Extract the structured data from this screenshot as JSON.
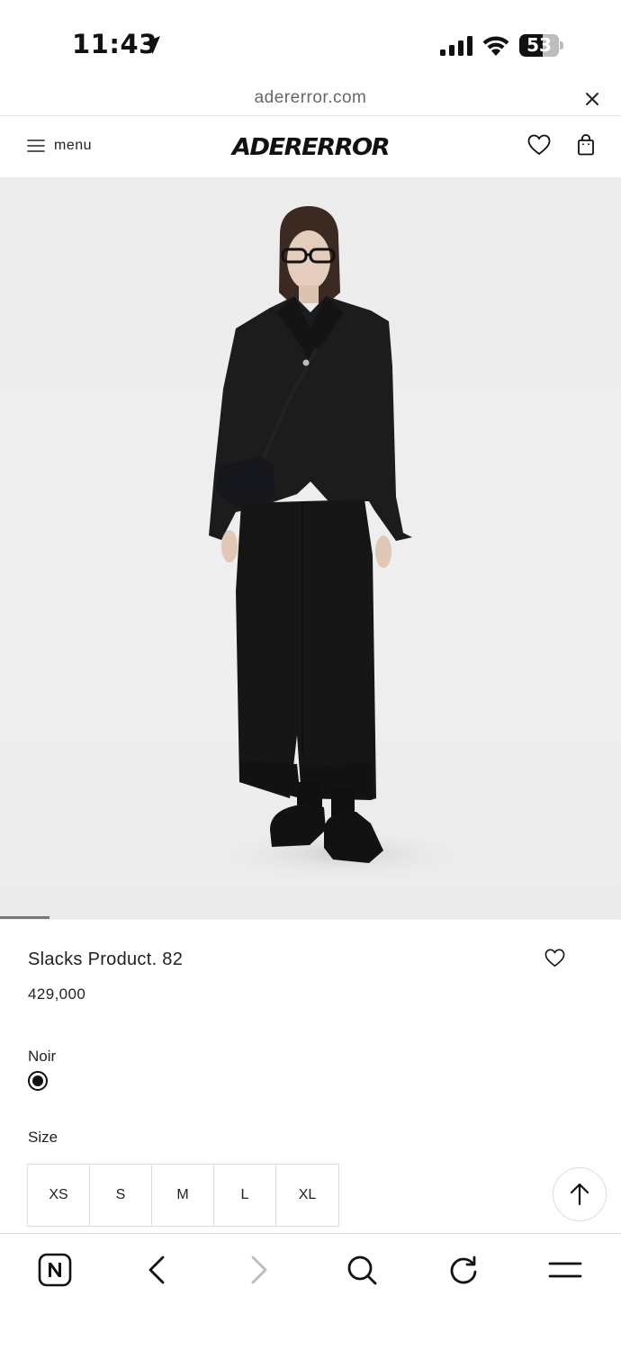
{
  "status_bar": {
    "time": "11:43",
    "battery": "53",
    "icons": [
      "location-arrow-icon",
      "signal-icon",
      "wifi-icon",
      "battery-icon"
    ]
  },
  "browser": {
    "url": "adererror.com"
  },
  "header": {
    "menu_label": "menu",
    "logo": "ADERERROR"
  },
  "gallery": {
    "image_progress": 0.08
  },
  "product": {
    "name": "Slacks Product. 82",
    "price": "429,000",
    "color_label": "Noir",
    "size_label": "Size",
    "sizes": [
      "XS",
      "S",
      "M",
      "L",
      "XL"
    ]
  },
  "toolbar": {
    "icons": [
      "naver-icon",
      "back-icon",
      "forward-icon",
      "search-icon",
      "reload-icon",
      "menu-icon"
    ]
  }
}
